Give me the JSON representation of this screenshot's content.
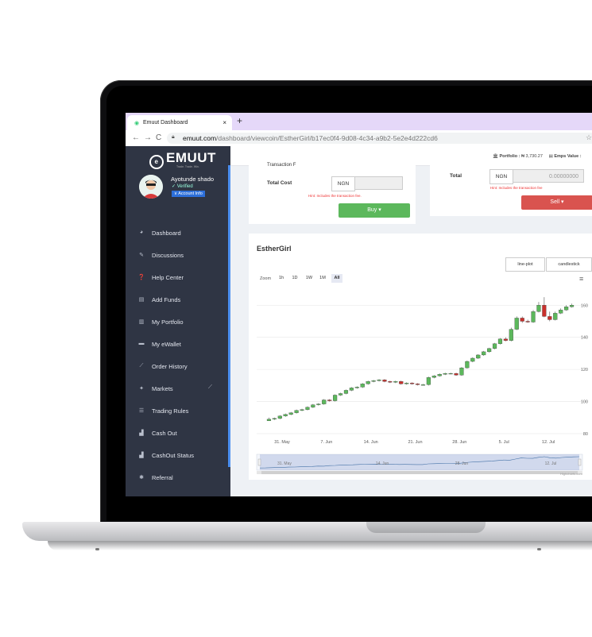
{
  "browser": {
    "tab_title": "Emuut Dashboard",
    "tab_close": "×",
    "new_tab": "+",
    "url_domain": "emuut.com",
    "url_path": "/dashboard/viewcoin/EstherGirl/b17ec0f4-9d08-4c34-a9b2-5e2e4d222cd6",
    "back": "←",
    "forward": "→",
    "reload": "C",
    "star": "☆"
  },
  "sidebar": {
    "logo": "EMUUT",
    "tagline": "Trade. Trade. Win.",
    "user_name": "Ayotunde shado",
    "verified": "✓ Verified",
    "account_info": "∨ Account Info",
    "items": [
      {
        "label": "Dashboard",
        "icon": "dashboard-icon",
        "glyph": "◕"
      },
      {
        "label": "Discussions",
        "icon": "discussions-icon",
        "glyph": "✎"
      },
      {
        "label": "Help Center",
        "icon": "help-icon",
        "glyph": "❓"
      },
      {
        "label": "Add Funds",
        "icon": "add-funds-icon",
        "glyph": "▤"
      },
      {
        "label": "My Portfolio",
        "icon": "portfolio-icon",
        "glyph": "▥"
      },
      {
        "label": "My eWallet",
        "icon": "wallet-icon",
        "glyph": "▬"
      },
      {
        "label": "Order History",
        "icon": "order-history-icon",
        "glyph": "⟋"
      },
      {
        "label": "Markets",
        "icon": "markets-icon",
        "glyph": "✦"
      },
      {
        "label": "Trading Rules",
        "icon": "trading-rules-icon",
        "glyph": "☰"
      },
      {
        "label": "Cash Out",
        "icon": "cash-out-icon",
        "glyph": "▟"
      },
      {
        "label": "CashOut Status",
        "icon": "cashout-status-icon",
        "glyph": "▟"
      },
      {
        "label": "Referral",
        "icon": "referral-icon",
        "glyph": "✱"
      }
    ],
    "markets_side_glyph": "⟋"
  },
  "topbar": {
    "portfolio_label": "Portfolio :",
    "portfolio_value": "₦ 3,730.27",
    "emps_label": "Emps Value :"
  },
  "buy": {
    "cut_label": "Transaction F",
    "total_cost_label": "Total Cost",
    "currency": "NGN",
    "value": "",
    "hint": "Hint: Includes the transaction fee.",
    "button": "Buy ▾"
  },
  "sell": {
    "total_label": "Total",
    "currency": "NGN",
    "value": "0.00000000",
    "hint": "Hint: Includes the transaction fee",
    "button": "Sell ▾"
  },
  "chart_panel": {
    "coin_name": "EstherGirl",
    "view_buttons": [
      "line-plot",
      "candlestick"
    ],
    "zoom_label": "Zoom",
    "zoom_buttons": [
      "1h",
      "1D",
      "1W",
      "1M",
      "All"
    ],
    "zoom_selected": "All",
    "menu_glyph": "≡",
    "credit": "Highcharts.com"
  },
  "chart_data": {
    "type": "candlestick",
    "title": "",
    "x_ticks": [
      "31. May",
      "7. Jun",
      "14. Jun",
      "21. Jun",
      "28. Jun",
      "5. Jul",
      "12. Jul"
    ],
    "y_ticks": [
      80,
      100,
      120,
      140,
      160
    ],
    "ylim": [
      80,
      172
    ],
    "up_color": "#5cb85c",
    "down_color": "#c9302c",
    "series": [
      {
        "candles": [
          [
            88,
            89,
            90,
            88
          ],
          [
            89,
            89.5,
            90,
            88.5
          ],
          [
            89.5,
            91,
            91.5,
            89
          ],
          [
            91,
            92,
            92.5,
            90.5
          ],
          [
            92,
            93,
            93.5,
            91.5
          ],
          [
            93,
            94.5,
            95,
            92.5
          ],
          [
            94.5,
            95,
            95.5,
            94
          ],
          [
            95,
            96.5,
            97,
            94.5
          ],
          [
            96.5,
            98,
            98.5,
            96
          ],
          [
            98,
            98.5,
            99,
            97.5
          ],
          [
            98.5,
            101,
            101.5,
            98
          ],
          [
            101,
            100.5,
            101.5,
            100
          ],
          [
            100.5,
            104,
            104.5,
            100
          ],
          [
            104,
            105,
            105.5,
            103.5
          ],
          [
            105,
            107,
            107.5,
            104.5
          ],
          [
            107,
            108.5,
            109,
            106.5
          ],
          [
            108.5,
            109,
            109.5,
            108
          ],
          [
            109,
            111,
            111.5,
            108.5
          ],
          [
            111,
            112.5,
            113,
            110.5
          ],
          [
            112.5,
            113,
            113.5,
            112
          ],
          [
            113,
            113.5,
            114,
            112.5
          ],
          [
            113.5,
            112.5,
            114,
            112
          ],
          [
            112.5,
            112,
            113,
            111.5
          ],
          [
            112,
            112.5,
            113,
            111.5
          ],
          [
            112.5,
            111,
            113,
            110.5
          ],
          [
            111,
            111.5,
            112,
            110.5
          ],
          [
            111.5,
            111,
            112,
            110.5
          ],
          [
            111,
            110.5,
            111.5,
            110
          ],
          [
            110.5,
            110.5,
            111,
            110
          ],
          [
            110.5,
            115,
            115.5,
            110
          ],
          [
            115,
            116,
            116.5,
            114.5
          ],
          [
            116,
            117,
            117.5,
            115.5
          ],
          [
            117,
            117.5,
            118,
            116.5
          ],
          [
            117.5,
            117.5,
            118,
            117
          ],
          [
            117.5,
            116.5,
            118,
            116
          ],
          [
            116.5,
            121,
            121.5,
            116
          ],
          [
            121,
            125,
            125.5,
            120.5
          ],
          [
            125,
            127,
            127.5,
            124.5
          ],
          [
            127,
            129,
            129.5,
            126.5
          ],
          [
            129,
            131,
            131.5,
            128.5
          ],
          [
            131,
            133,
            133.5,
            130.5
          ],
          [
            133,
            136,
            136.5,
            132.5
          ],
          [
            136,
            139,
            139.5,
            135.5
          ],
          [
            139,
            138,
            140,
            137.5
          ],
          [
            138,
            145,
            146,
            137.5
          ],
          [
            145,
            152,
            153,
            144.5
          ],
          [
            152,
            150,
            153,
            149
          ],
          [
            150,
            149.5,
            151,
            149
          ],
          [
            149.5,
            156,
            157,
            149
          ],
          [
            156,
            160,
            162,
            155.5
          ],
          [
            160,
            153,
            165,
            152.5
          ],
          [
            153,
            151,
            156,
            150
          ],
          [
            151,
            155,
            156,
            150.5
          ],
          [
            155,
            157,
            158,
            154.5
          ],
          [
            157,
            159,
            160,
            156.5
          ],
          [
            159,
            160,
            161,
            158.5
          ]
        ]
      }
    ],
    "navigator": {
      "x_ticks": [
        "31. May",
        "14. Jun",
        "28. Jun",
        "12. Jul"
      ]
    }
  }
}
